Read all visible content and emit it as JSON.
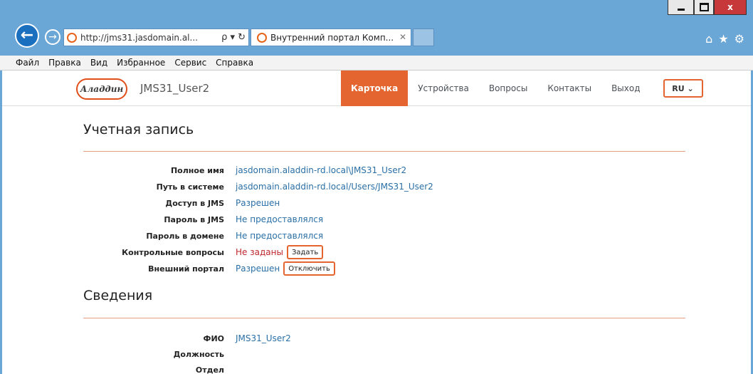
{
  "browser": {
    "address_url": "http://jms31.jasdomain.al...",
    "address_tools": "ρ ▾ ↻",
    "tab_title": "Внутренний портал Комп...",
    "tab_close": "✕",
    "back_glyph": "←",
    "forward_glyph": "→",
    "right_icons": [
      "⌂",
      "★",
      "⚙"
    ],
    "window_close": "x"
  },
  "menu": [
    "Файл",
    "Правка",
    "Вид",
    "Избранное",
    "Сервис",
    "Справка"
  ],
  "header": {
    "logo_text": "Аладдин",
    "username": "JMS31_User2",
    "nav": [
      "Карточка",
      "Устройства",
      "Вопросы",
      "Контакты",
      "Выход"
    ],
    "active_nav_index": 0,
    "lang": "RU ⌄"
  },
  "account": {
    "title": "Учетная запись",
    "rows": [
      {
        "label": "Полное имя",
        "value": "jasdomain.aladdin-rd.local\\JMS31_User2"
      },
      {
        "label": "Путь в системе",
        "value": "jasdomain.aladdin-rd.local/Users/JMS31_User2"
      },
      {
        "label": "Доступ в JMS",
        "value": "Разрешен"
      },
      {
        "label": "Пароль в JMS",
        "value": "Не предоставлялся"
      },
      {
        "label": "Пароль в домене",
        "value": "Не предоставлялся"
      },
      {
        "label": "Контрольные вопросы",
        "value": "Не заданы",
        "button": "Задать"
      },
      {
        "label": "Внешний портал",
        "value": "Разрешен",
        "button": "Отключить"
      }
    ]
  },
  "info": {
    "title": "Сведения",
    "rows": [
      {
        "label": "ФИО",
        "value": "JMS31_User2"
      },
      {
        "label": "Должность",
        "value": ""
      },
      {
        "label": "Отдел",
        "value": ""
      }
    ]
  },
  "colors": {
    "accent": "#e4652f",
    "link": "#2a6fa6",
    "warning": "#c0272d",
    "chrome": "#6aa6d6"
  }
}
